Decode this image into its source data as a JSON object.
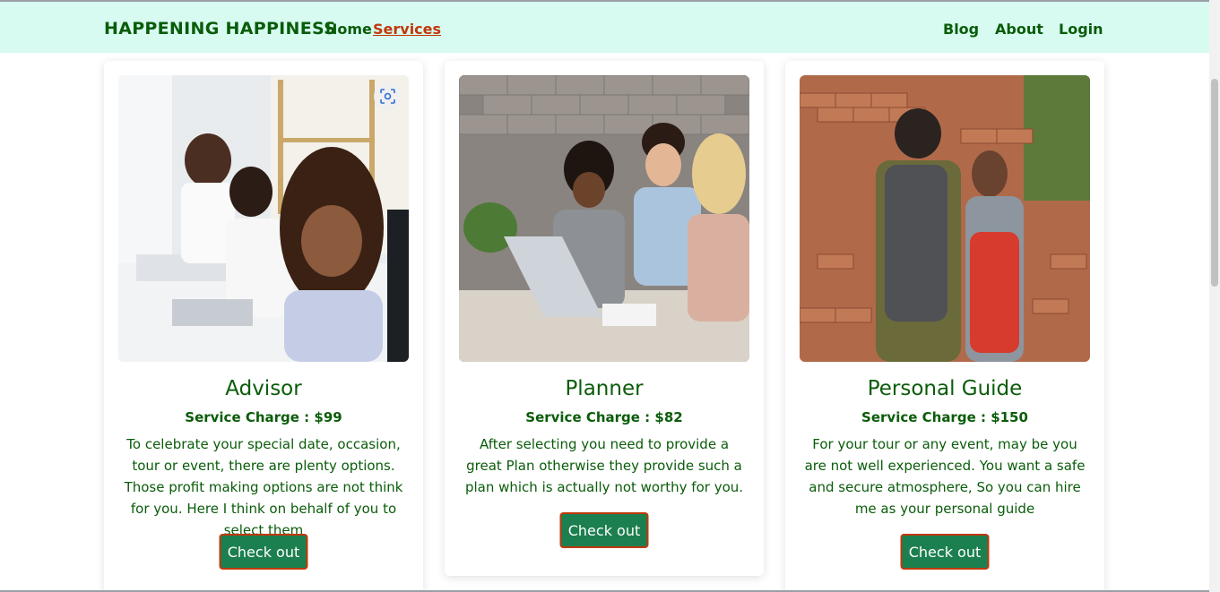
{
  "nav": {
    "brand": "HAPPENING HAPPINESS",
    "links_left": [
      "Home",
      "Services"
    ],
    "links_right": [
      "Blog",
      "About",
      "Login"
    ],
    "active": "Services"
  },
  "cards": [
    {
      "title": "Advisor",
      "charge": "Service Charge : $99",
      "description": "To celebrate your special date, occasion, tour or event, there are plenty options. Those profit making options are not think for you. Here I think on behalf of you to select them",
      "button": "Check out",
      "image_alt": "office-team-photo"
    },
    {
      "title": "Planner",
      "charge": "Service Charge : $82",
      "description": "After selecting you need to provide a great Plan otherwise they provide such a plan which is actually not worthy for you.",
      "button": "Check out",
      "image_alt": "meeting-photo"
    },
    {
      "title": "Personal Guide",
      "charge": "Service Charge : $150",
      "description": "For your tour or any event, may be you are not well experienced. You want a safe and secure atmosphere, So you can hire me as your personal guide",
      "button": "Check out",
      "image_alt": "travelers-photo"
    }
  ],
  "icons": {
    "visual_search": "lens-icon"
  },
  "colors": {
    "brand_green": "#0a5c0a",
    "nav_bg": "#d7fbf1",
    "active_link": "#c0390b",
    "button_bg": "#1c7f4f",
    "button_border": "#c0390b"
  }
}
